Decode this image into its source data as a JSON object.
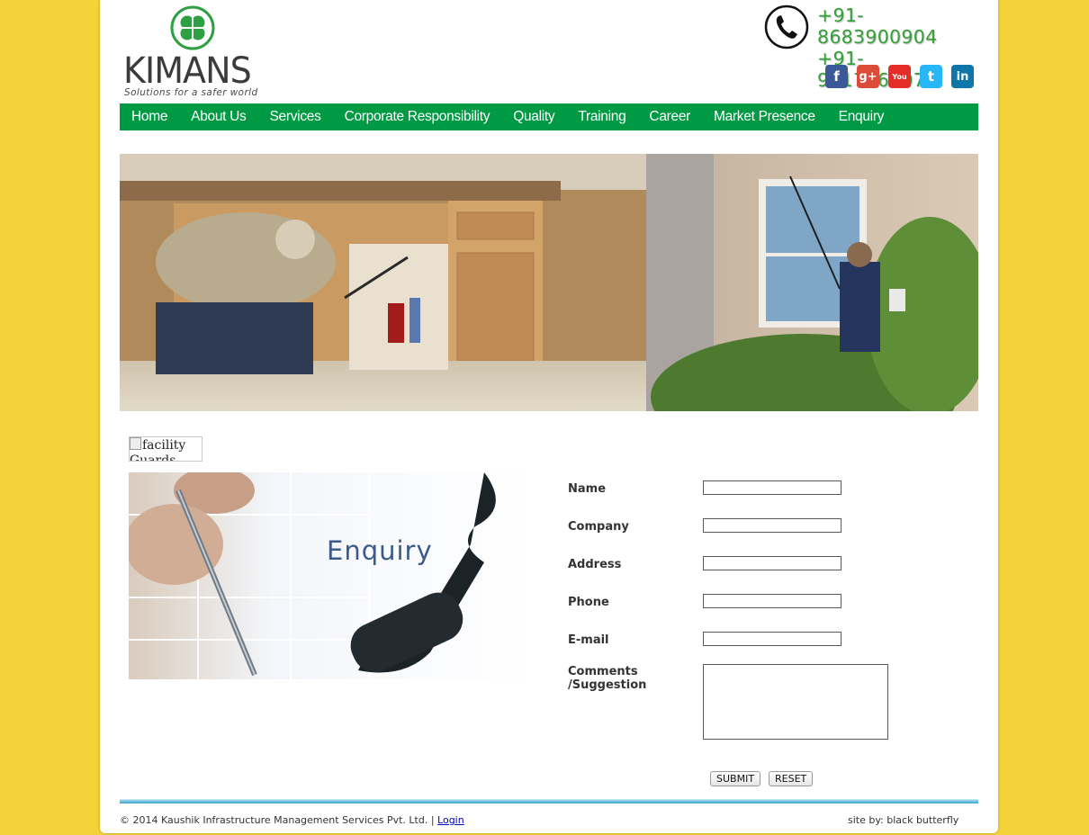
{
  "header": {
    "brand": "KIMANS",
    "tagline": "Solutions for a safer world",
    "phones": [
      "+91-8683900904",
      "+91-9717666077"
    ],
    "social": [
      {
        "icon": "facebook-icon",
        "glyph": "f",
        "color": "#3b5998"
      },
      {
        "icon": "google-plus-icon",
        "glyph": "g+",
        "color": "#dd4b39"
      },
      {
        "icon": "youtube-icon",
        "glyph": "You",
        "color": "#e52d27"
      },
      {
        "icon": "twitter-icon",
        "glyph": "t",
        "color": "#29b6f6"
      },
      {
        "icon": "linkedin-icon",
        "glyph": "in",
        "color": "#0e76a8"
      }
    ]
  },
  "nav": {
    "items": [
      "Home",
      "About Us",
      "Services",
      "Corporate Responsibility",
      "Quality",
      "Training",
      "Career",
      "Market Presence",
      "Enquiry"
    ]
  },
  "content": {
    "broken_image_alt": "facility Guards",
    "enquiry_image_text": "Enquiry"
  },
  "form": {
    "labels": {
      "name": "Name",
      "company": "Company",
      "address": "Address",
      "phone": "Phone",
      "email": "E-mail",
      "comments_line1": "Comments",
      "comments_line2": "/Suggestion"
    },
    "submit_label": "SUBMIT",
    "reset_label": "RESET"
  },
  "footer": {
    "copyright": "© 2014 Kaushik Infrastructure Management Services Pvt. Ltd. |",
    "login_label": "Login",
    "credit": "site by: black butterfly"
  },
  "colors": {
    "page_bg": "#f3d23a",
    "nav_bg": "#009a44",
    "phone_text": "#36a03a"
  }
}
